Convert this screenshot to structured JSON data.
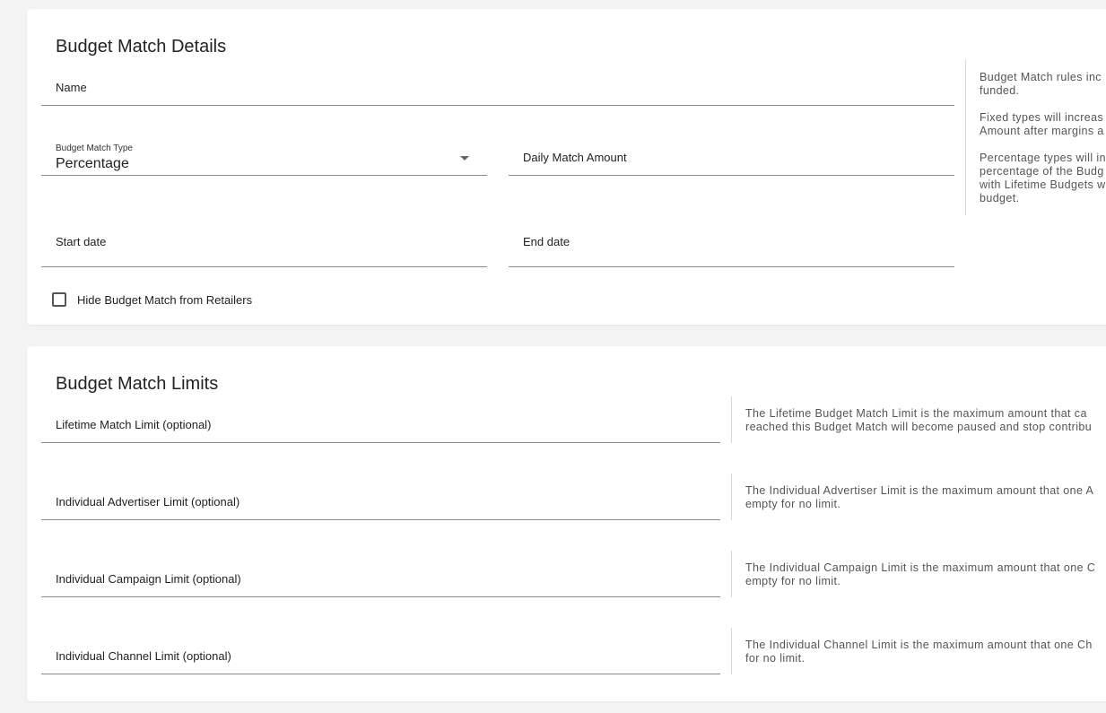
{
  "details": {
    "title": "Budget Match Details",
    "name_label": "Name",
    "type_label": "Budget Match Type",
    "type_value": "Percentage",
    "daily_amount_label": "Daily Match Amount",
    "start_date_label": "Start date",
    "end_date_label": "End date",
    "hide_checkbox_label": "Hide Budget Match from Retailers",
    "help": {
      "p1_l1": "Budget Match rules inc",
      "p1_l2": "funded.",
      "p2_l1": "Fixed types will increas",
      "p2_l2": "Amount after margins a",
      "p3_l1": "Percentage types will in",
      "p3_l2": "percentage of the Budg",
      "p3_l3": "with Lifetime Budgets w",
      "p3_l4": "budget."
    }
  },
  "limits": {
    "title": "Budget Match Limits",
    "items": [
      {
        "label": "Lifetime Match Limit (optional)",
        "help_l1": "The Lifetime Budget Match Limit is the maximum amount that ca",
        "help_l2": "reached this Budget Match will become paused and stop contribu"
      },
      {
        "label": "Individual Advertiser Limit (optional)",
        "help_l1": "The Individual Advertiser Limit is the maximum amount that one A",
        "help_l2": "empty for no limit."
      },
      {
        "label": "Individual Campaign Limit (optional)",
        "help_l1": "The Individual Campaign Limit is the maximum amount that one C",
        "help_l2": "empty for no limit."
      },
      {
        "label": "Individual Channel Limit (optional)",
        "help_l1": "The Individual Channel Limit is the maximum amount that one Ch",
        "help_l2": "for no limit."
      }
    ]
  },
  "icons": {
    "dropdown": "chevron-down-icon",
    "checkbox": "checkbox-unchecked-icon"
  },
  "colors": {
    "background": "#f3f3f3",
    "card": "#ffffff",
    "underline": "#8a8a8a",
    "help_text": "#555555"
  }
}
